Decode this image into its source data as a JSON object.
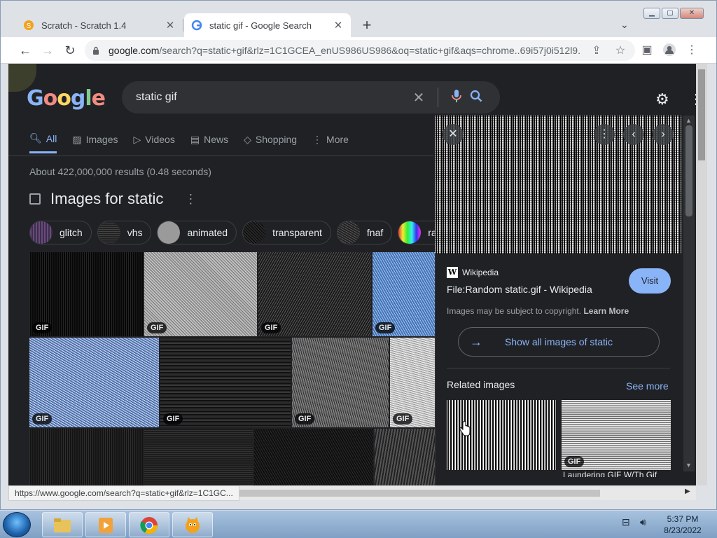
{
  "browser": {
    "tabs": [
      {
        "title": "Scratch - Scratch 1.4",
        "active": false
      },
      {
        "title": "static gif - Google Search",
        "active": true
      }
    ],
    "url_host": "google.com",
    "url_rest": "/search?q=static+gif&rlz=1C1GCEA_enUS986US986&oq=static+gif&aqs=chrome..69i57j0i512l9...",
    "status_url": "https://www.google.com/search?q=static+gif&rlz=1C1GC..."
  },
  "google": {
    "logo_letters": [
      "G",
      "o",
      "o",
      "g",
      "l",
      "e"
    ],
    "query": "static gif",
    "nav_tabs": [
      {
        "label": "All",
        "icon": "search-icon",
        "active": true
      },
      {
        "label": "Images",
        "icon": "image-icon",
        "active": false
      },
      {
        "label": "Videos",
        "icon": "play-icon",
        "active": false
      },
      {
        "label": "News",
        "icon": "news-icon",
        "active": false
      },
      {
        "label": "Shopping",
        "icon": "tag-icon",
        "active": false
      },
      {
        "label": "More",
        "icon": "kebab-icon",
        "active": false
      }
    ],
    "result_stats": "About 422,000,000 results (0.48 seconds)",
    "images_heading": "Images for static",
    "chips": [
      "glitch",
      "vhs",
      "animated",
      "transparent",
      "fnaf",
      "rainb"
    ],
    "gif_badge": "GIF"
  },
  "panel": {
    "source": "Wikipedia",
    "title": "File:Random static.gif - Wikipedia",
    "visit_label": "Visit",
    "copyright_text": "Images may be subject to copyright.",
    "learn_more": "Learn More",
    "show_all": "Show all images of static",
    "related_heading": "Related images",
    "see_more": "See more",
    "related_caption": "Laundering GIF W/Th Gif"
  },
  "taskbar": {
    "time": "5:37 PM",
    "date": "8/23/2022"
  },
  "colors": {
    "page_bg": "#202124",
    "accent": "#8ab4f8",
    "text": "#e8eaed",
    "muted": "#9aa0a6"
  }
}
